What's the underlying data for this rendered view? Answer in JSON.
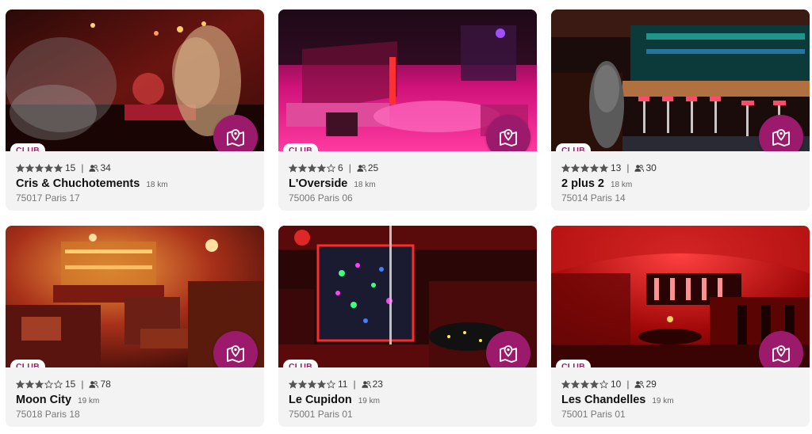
{
  "venues": [
    {
      "badge": "CLUB",
      "rating_count": "15",
      "stars": 5,
      "people": "34",
      "name": "Cris & Chuchotements",
      "distance": "18 km",
      "address": "75017 Paris 17"
    },
    {
      "badge": "CLUB",
      "rating_count": "6",
      "stars": 4,
      "people": "25",
      "name": "L'Overside",
      "distance": "18 km",
      "address": "75006 Paris 06"
    },
    {
      "badge": "CLUB",
      "rating_count": "13",
      "stars": 5,
      "people": "30",
      "name": "2 plus 2",
      "distance": "18 km",
      "address": "75014 Paris 14"
    },
    {
      "badge": "CLUB",
      "rating_count": "15",
      "stars": 3,
      "people": "78",
      "name": "Moon City",
      "distance": "19 km",
      "address": "75018 Paris 18"
    },
    {
      "badge": "CLUB",
      "rating_count": "11",
      "stars": 4,
      "people": "23",
      "name": "Le Cupidon",
      "distance": "19 km",
      "address": "75001 Paris 01"
    },
    {
      "badge": "CLUB",
      "rating_count": "10",
      "stars": 4,
      "people": "29",
      "name": "Les Chandelles",
      "distance": "19 km",
      "address": "75001 Paris 01"
    }
  ],
  "icons": {
    "map_button": "map-pin-icon",
    "people": "people-icon",
    "star_full": "star-filled-icon",
    "star_empty": "star-empty-icon"
  },
  "colors": {
    "accent": "#9b1a6b",
    "card_bg": "#f3f3f4"
  }
}
